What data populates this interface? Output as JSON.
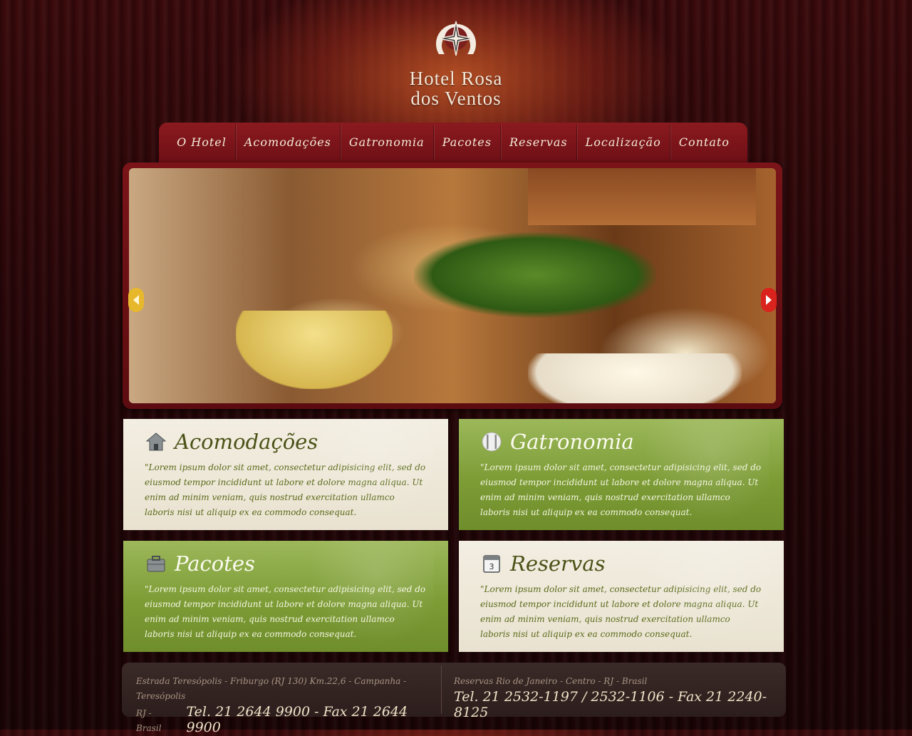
{
  "brand": {
    "line1": "Hotel Rosa",
    "line2": "dos Ventos",
    "logo_icon": "compass-horseshoe-icon"
  },
  "nav": {
    "items": [
      "O Hotel",
      "Acomodações",
      "Gatronomia",
      "Pacotes",
      "Reservas",
      "Localização",
      "Contato"
    ]
  },
  "slider": {
    "image": "restaurant-dining-room-photo",
    "prev_icon": "arrow-left-icon",
    "next_icon": "arrow-right-icon"
  },
  "cards": [
    {
      "title": "Acomodações",
      "icon": "house-icon",
      "text": "\"Lorem ipsum dolor sit amet, consectetur adipisicing elit, sed do eiusmod tempor incididunt ut labore et dolore magna aliqua. Ut enim ad minim veniam, quis nostrud exercitation ullamco laboris nisi ut aliquip ex ea commodo consequat."
    },
    {
      "title": "Gatronomia",
      "icon": "cutlery-icon",
      "text": "\"Lorem ipsum dolor sit amet, consectetur adipisicing elit, sed do eiusmod tempor incididunt ut labore et dolore magna aliqua. Ut enim ad minim veniam, quis nostrud exercitation ullamco laboris nisi ut aliquip ex ea commodo consequat."
    },
    {
      "title": "Pacotes",
      "icon": "suitcase-icon",
      "text": "\"Lorem ipsum dolor sit amet, consectetur adipisicing elit, sed do eiusmod tempor incididunt ut labore et dolore magna aliqua. Ut enim ad minim veniam, quis nostrud exercitation ullamco laboris nisi ut aliquip ex ea commodo consequat."
    },
    {
      "title": "Reservas",
      "icon": "calendar-icon",
      "text": "\"Lorem ipsum dolor sit amet, consectetur adipisicing elit, sed do eiusmod tempor incididunt ut labore et dolore magna aliqua. Ut enim ad minim veniam, quis nostrud exercitation ullamco laboris nisi ut aliquip ex ea commodo consequat."
    }
  ],
  "footer": {
    "left": {
      "address_line1": "Estrada Teresópolis - Friburgo (RJ 130) Km.22,6 - Campanha - Teresópolis",
      "address_line2": "RJ - Brasil",
      "phone": "Tel. 21 2644 9900 - Fax 21 2644 9900"
    },
    "right": {
      "address": "Reservas Rio de Janeiro - Centro - RJ - Brasil",
      "phone": "Tel. 21 2532-1197 / 2532-1106 - Fax 21 2240-8125"
    }
  },
  "colors": {
    "nav_bg": "#7a1419",
    "card_green": "#7d9c36",
    "card_light": "#efe9db",
    "footer_bg": "#33231f"
  }
}
